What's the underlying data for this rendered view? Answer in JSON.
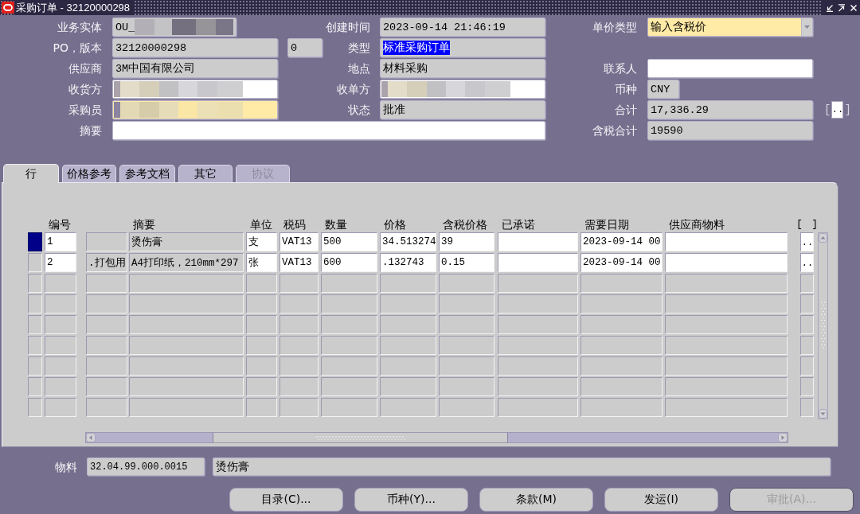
{
  "window": {
    "title": "采购订单 - 32120000298"
  },
  "header": {
    "rows": [
      {
        "cells": [
          {
            "label": "业务实体",
            "value": "OU_",
            "kind": "readonly",
            "highlighted": false,
            "redacted": true
          },
          {
            "label": "创建时间",
            "value": "2023-09-14 21:46:19",
            "kind": "readonly",
            "highlighted": false,
            "redacted": false
          }
        ]
      },
      {
        "cells": [
          {
            "label": "PO，版本",
            "value": "32120000298",
            "kind": "readonly",
            "highlighted": false,
            "redacted": false,
            "extra": {
              "value": "0",
              "kind": "readonly",
              "highlighted": false,
              "redacted": false
            }
          },
          {
            "label": "类型",
            "value": "标准采购订单",
            "kind": "readonly",
            "highlighted": true,
            "redacted": false
          }
        ]
      },
      {
        "cells": [
          {
            "label": "供应商",
            "value": "3M中国有限公司",
            "kind": "readonly",
            "highlighted": false,
            "redacted": false
          },
          {
            "label": "地点",
            "value": "材料采购",
            "kind": "readonly",
            "highlighted": false,
            "redacted": false
          }
        ]
      },
      {
        "cells": [
          {
            "label": "收货方",
            "kind": "editable",
            "redacted": true
          },
          {
            "label": "收单方",
            "kind": "editable",
            "redacted": true
          }
        ]
      },
      {
        "cells": [
          {
            "label": "采购员",
            "kind": "required",
            "redacted": true
          },
          {
            "label": "状态",
            "value": "批准",
            "kind": "readonly",
            "highlighted": false,
            "redacted": false
          }
        ]
      }
    ],
    "summary": {
      "label": "摘要",
      "kind": "editable",
      "redacted": false
    },
    "side_top": [
      {
        "label": "单价类型",
        "value": "输入含税价",
        "kind": "required",
        "highlighted": false,
        "redacted": false,
        "dropdown": true
      }
    ],
    "side": [
      {
        "label": "联系人",
        "kind": "editable",
        "redacted": false,
        "dropdown": false
      },
      {
        "label": "币种",
        "value": "CNY",
        "kind": "readonly",
        "highlighted": false,
        "redacted": false,
        "dropdown": false
      },
      {
        "label": "合计",
        "value": "17,336.29",
        "kind": "readonly",
        "highlighted": false,
        "redacted": false,
        "dropdown": false,
        "more": {
          "open": "[",
          "label": "..",
          "close": "]"
        }
      },
      {
        "label": "含税合计",
        "value": "19590",
        "kind": "readonly",
        "highlighted": false,
        "redacted": false,
        "dropdown": false
      }
    ]
  },
  "tabs": [
    {
      "label": "行",
      "selected": true,
      "disabled": false
    },
    {
      "label": "价格参考",
      "selected": false,
      "disabled": false
    },
    {
      "label": "参考文档",
      "selected": false,
      "disabled": false
    },
    {
      "label": "其它",
      "selected": false,
      "disabled": false
    },
    {
      "label": "协议",
      "selected": false,
      "disabled": true
    }
  ],
  "lines": {
    "columns": [
      {
        "label": "编号",
        "kind": "editable"
      },
      {
        "kind": "readonly"
      },
      {
        "label": "摘要",
        "kind": "readonly"
      },
      {
        "label": "单位",
        "kind": "editable"
      },
      {
        "label": "税码",
        "kind": "editable"
      },
      {
        "label": "数量",
        "kind": "editable"
      },
      {
        "label": "价格",
        "kind": "editable"
      },
      {
        "label": "含税价格",
        "kind": "editable"
      },
      {
        "label": "已承诺",
        "kind": "editable"
      },
      {
        "label": "需要日期",
        "kind": "editable"
      },
      {
        "label": "供应商物料",
        "kind": "editable"
      }
    ],
    "more_header": {
      "open": "[",
      "close": "]"
    },
    "rows": [
      {
        "kind": "line",
        "selected": true,
        "cells": [
          {
            "value": "1"
          },
          {},
          {
            "value": "烫伤膏"
          },
          {
            "value": "支"
          },
          {
            "value": "VAT13"
          },
          {
            "value": "500"
          },
          {
            "value": "34.513274"
          },
          {
            "value": "39"
          },
          {},
          {
            "value": "2023-09-14 00"
          },
          {}
        ],
        "more": ".."
      },
      {
        "kind": "line",
        "selected": false,
        "cells": [
          {
            "value": "2"
          },
          {
            "value": ".打包用"
          },
          {
            "value": "A4打印纸，210mm*297"
          },
          {
            "value": "张"
          },
          {
            "value": "VAT13"
          },
          {
            "value": "600"
          },
          {
            "value": ".132743"
          },
          {
            "value": "0.15"
          },
          {},
          {
            "value": "2023-09-14 00"
          },
          {}
        ],
        "more": ".."
      },
      {
        "kind": "empty",
        "selected": false
      },
      {
        "kind": "empty",
        "selected": false
      },
      {
        "kind": "empty",
        "selected": false
      },
      {
        "kind": "empty",
        "selected": false
      },
      {
        "kind": "empty",
        "selected": false
      },
      {
        "kind": "empty",
        "selected": false
      },
      {
        "kind": "empty",
        "selected": false
      }
    ]
  },
  "item": {
    "label": "物料",
    "code": {
      "value": "32.04.99.000.0015",
      "kind": "readonly"
    },
    "description": {
      "value": "烫伤膏",
      "kind": "readonly"
    }
  },
  "buttons": [
    {
      "label": "目录(C)...",
      "disabled": false
    },
    {
      "label": "币种(Y)...",
      "disabled": false
    },
    {
      "label": "条款(M)",
      "disabled": false
    },
    {
      "label": "发运(I)",
      "disabled": false
    },
    {
      "label": "审批(A)...",
      "disabled": true
    }
  ]
}
